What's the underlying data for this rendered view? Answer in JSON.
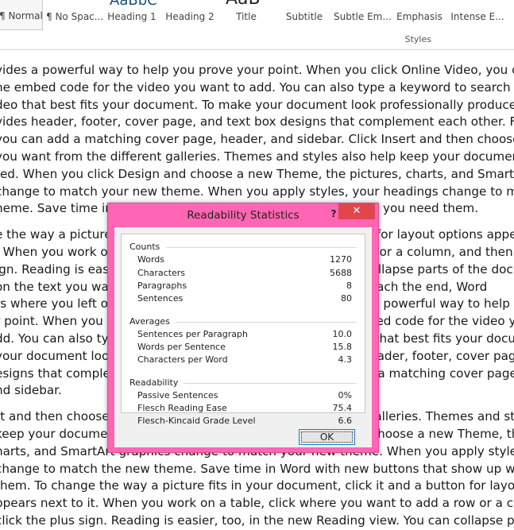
{
  "ribbon": {
    "styles": [
      {
        "label": "¶ Normal"
      },
      {
        "label": "¶ No Spac..."
      },
      {
        "label": "Heading 1"
      },
      {
        "label": "Heading 2"
      },
      {
        "label": "Title"
      },
      {
        "label": "Subtitle"
      },
      {
        "label": "Subtle Em..."
      },
      {
        "label": "Emphasis"
      },
      {
        "label": "Intense E..."
      }
    ],
    "preview_peek_1": "AaBbC",
    "preview_peek_2": "AaB",
    "caption": "Styles"
  },
  "document": {
    "paragraphs": [
      [
        "vides a powerful way to help you prove your point. When you click Online Video, you can",
        "he embed code for the video you want to add. You can also type a keyword to search online",
        "deo that best fits your document. To make your document look professionally produced,",
        "vides header, footer, cover page, and text box designs that complement each other. For",
        "you can add a matching cover page, header, and sidebar. Click Insert and then choose the",
        "you want from the different galleries. Themes and styles also help keep your document",
        "ted. When you click Design and choose a new Theme, the pictures, charts, and SmartArt",
        "change to match your new theme. When you apply styles, your headings change to match",
        "heme. Save time in Word with new buttons that show up where you need them."
      ],
      [
        "e the way a picture fits in your document, click it and a button for layout options appears",
        ". When you work on a table, click where you want to add a row or a column, and then click",
        "ign. Reading is easier, too, in the new Reading view. You can collapse parts of the document",
        " on the text you want. If you need to stop reading before you reach the end, Word",
        "rs where you left off - even on another device. Video provides a powerful way to help you",
        "r point. When you click Online Video, you can paste in the embed code for the video you",
        "dd. You can also type a keyword to search online for the video that best fits your document.",
        "your document look professionally produced, Word provides header, footer, cover page, and",
        "esigns that complement each other. For example, you can add a matching cover page,",
        "nd sidebar."
      ],
      [
        "rt and then choose the elements you want from the different galleries. Themes and styles",
        "keep your document coordinated. When you click Design and choose a new Theme, the",
        "harts, and SmartArt graphics change to match your new theme. When you apply styles, your",
        "change to match the new theme. Save time in Word with new buttons that show up where",
        "them. To change the way a picture fits in your document, click it and a button for layout",
        "ppears next to it. When you work on a table, click where you want to add a row or a column,",
        "click the plus sign. Reading is easier, too, in the new Reading view. You can collapse parts of"
      ]
    ]
  },
  "dialog": {
    "title": "Readability Statistics",
    "help_label": "?",
    "close_label": "✕",
    "ok_label": "OK",
    "counts": {
      "heading": "Counts",
      "rows": [
        {
          "label": "Words",
          "value": "1270"
        },
        {
          "label": "Characters",
          "value": "5688"
        },
        {
          "label": "Paragraphs",
          "value": "8"
        },
        {
          "label": "Sentences",
          "value": "80"
        }
      ]
    },
    "averages": {
      "heading": "Averages",
      "rows": [
        {
          "label": "Sentences per Paragraph",
          "value": "10.0"
        },
        {
          "label": "Words per Sentence",
          "value": "15.8"
        },
        {
          "label": "Characters per Word",
          "value": "4.3"
        }
      ]
    },
    "readability": {
      "heading": "Readability",
      "rows": [
        {
          "label": "Passive Sentences",
          "value": "0%"
        },
        {
          "label": "Flesch Reading Ease",
          "value": "75.4"
        },
        {
          "label": "Flesch-Kincaid Grade Level",
          "value": "6.6"
        }
      ]
    }
  },
  "colors": {
    "dialog_frame": "#ff66b3",
    "close_button": "#e0464b",
    "heading_blue": "#1f4e79"
  }
}
